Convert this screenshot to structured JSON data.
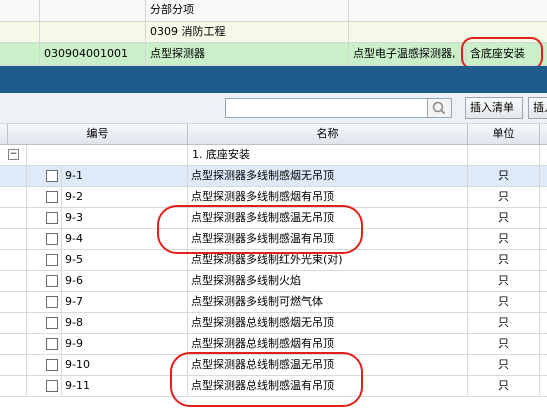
{
  "top_grid": {
    "header_col2": "分部分项",
    "group_row": {
      "label": "0309  消防工程"
    },
    "item_row": {
      "code": "030904001001",
      "name": "点型探测器",
      "description": "点型电子温感探测器,",
      "feature": "含底座安装"
    }
  },
  "toolbar": {
    "search": {
      "placeholder": "",
      "value": ""
    },
    "insert_list_label": "插入清单",
    "insert2_label": "插入"
  },
  "table": {
    "headers": {
      "code": "编号",
      "name": "名称",
      "unit": "单位"
    },
    "group": {
      "label": "1. 底座安装"
    },
    "rows": [
      {
        "code": "9-1",
        "name": "点型探测器多线制感烟无吊顶",
        "unit": "只"
      },
      {
        "code": "9-2",
        "name": "点型探测器多线制感烟有吊顶",
        "unit": "只"
      },
      {
        "code": "9-3",
        "name": "点型探测器多线制感温无吊顶",
        "unit": "只"
      },
      {
        "code": "9-4",
        "name": "点型探测器多线制感温有吊顶",
        "unit": "只"
      },
      {
        "code": "9-5",
        "name": "点型探测器多线制红外光束(对)",
        "unit": "只"
      },
      {
        "code": "9-6",
        "name": "点型探测器多线制火焰",
        "unit": "只"
      },
      {
        "code": "9-7",
        "name": "点型探测器多线制可燃气体",
        "unit": "只"
      },
      {
        "code": "9-8",
        "name": "点型探测器总线制感烟无吊顶",
        "unit": "只"
      },
      {
        "code": "9-9",
        "name": "点型探测器总线制感烟有吊顶",
        "unit": "只"
      },
      {
        "code": "9-10",
        "name": "点型探测器总线制感温无吊顶",
        "unit": "只"
      },
      {
        "code": "9-11",
        "name": "点型探测器总线制感温有吊顶",
        "unit": "只"
      }
    ]
  },
  "colors": {
    "band": "#1d5c8c",
    "highlight_row": "#c9f0c9",
    "group_row": "#f5f9e8",
    "annotation": "#e0201b"
  }
}
